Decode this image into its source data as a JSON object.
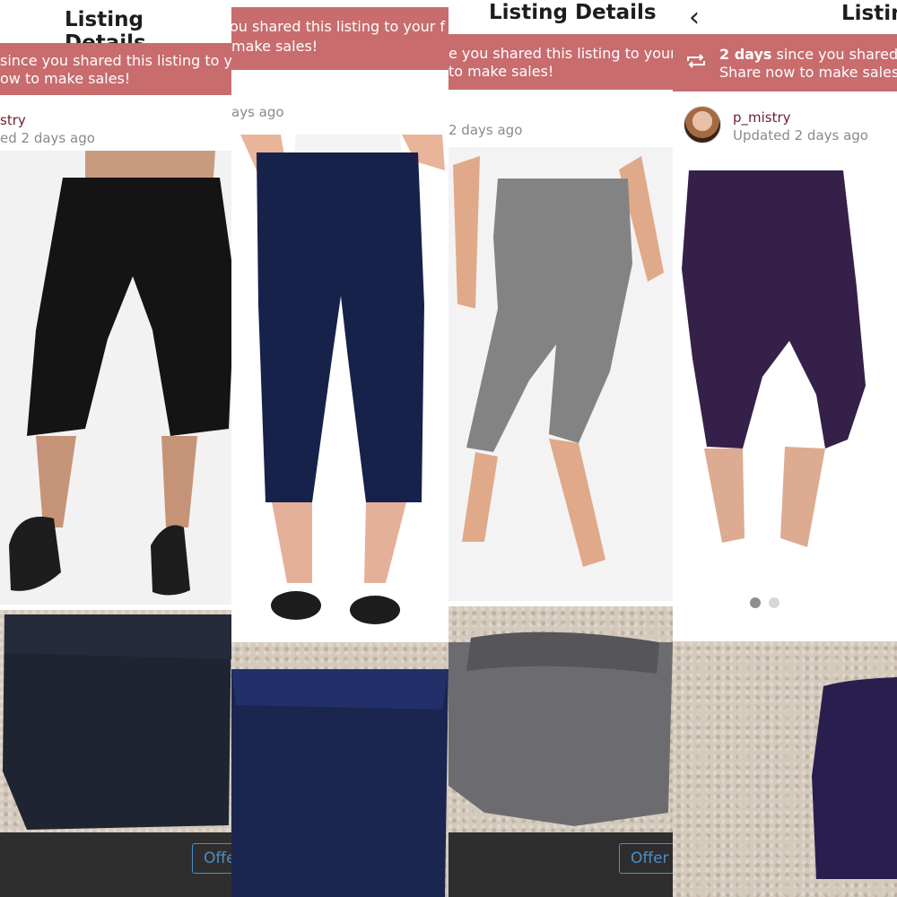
{
  "screens": [
    {
      "title": "Listing Details",
      "banner_line1": "since you shared this listing to your",
      "banner_line2": "ow to make sales!",
      "seller_name": "stry",
      "updated": "ed 2 days ago",
      "offer_label": ""
    },
    {
      "title": "",
      "banner_line1": "ou shared this listing to your f",
      "banner_line2": "make sales!",
      "seller_name": "",
      "updated": "ays ago",
      "offer_label": ""
    },
    {
      "title": "Listing Details",
      "banner_line1": "e you shared this listing to your fo",
      "banner_line2": "to make sales!",
      "seller_name": "",
      "updated": "2 days ago",
      "offer_label": "Offer"
    },
    {
      "title": "Listin",
      "banner_days": "2 days",
      "banner_line1_rest": " since you shared t",
      "banner_line2": "Share now to make sales!",
      "seller_name": "p_mistry",
      "updated": "Updated 2 days ago",
      "offer_label": ""
    }
  ],
  "offer_partial": "Offe",
  "icons": {
    "back": "chevron-left-icon",
    "share": "share-loop-icon"
  },
  "colors": {
    "banner": "#c86c6e",
    "seller_name": "#6e1f2f",
    "offer": "#4b8fc7",
    "bottom_bar": "#2e2e2e"
  },
  "carousel": {
    "total": 2,
    "active": 1
  }
}
